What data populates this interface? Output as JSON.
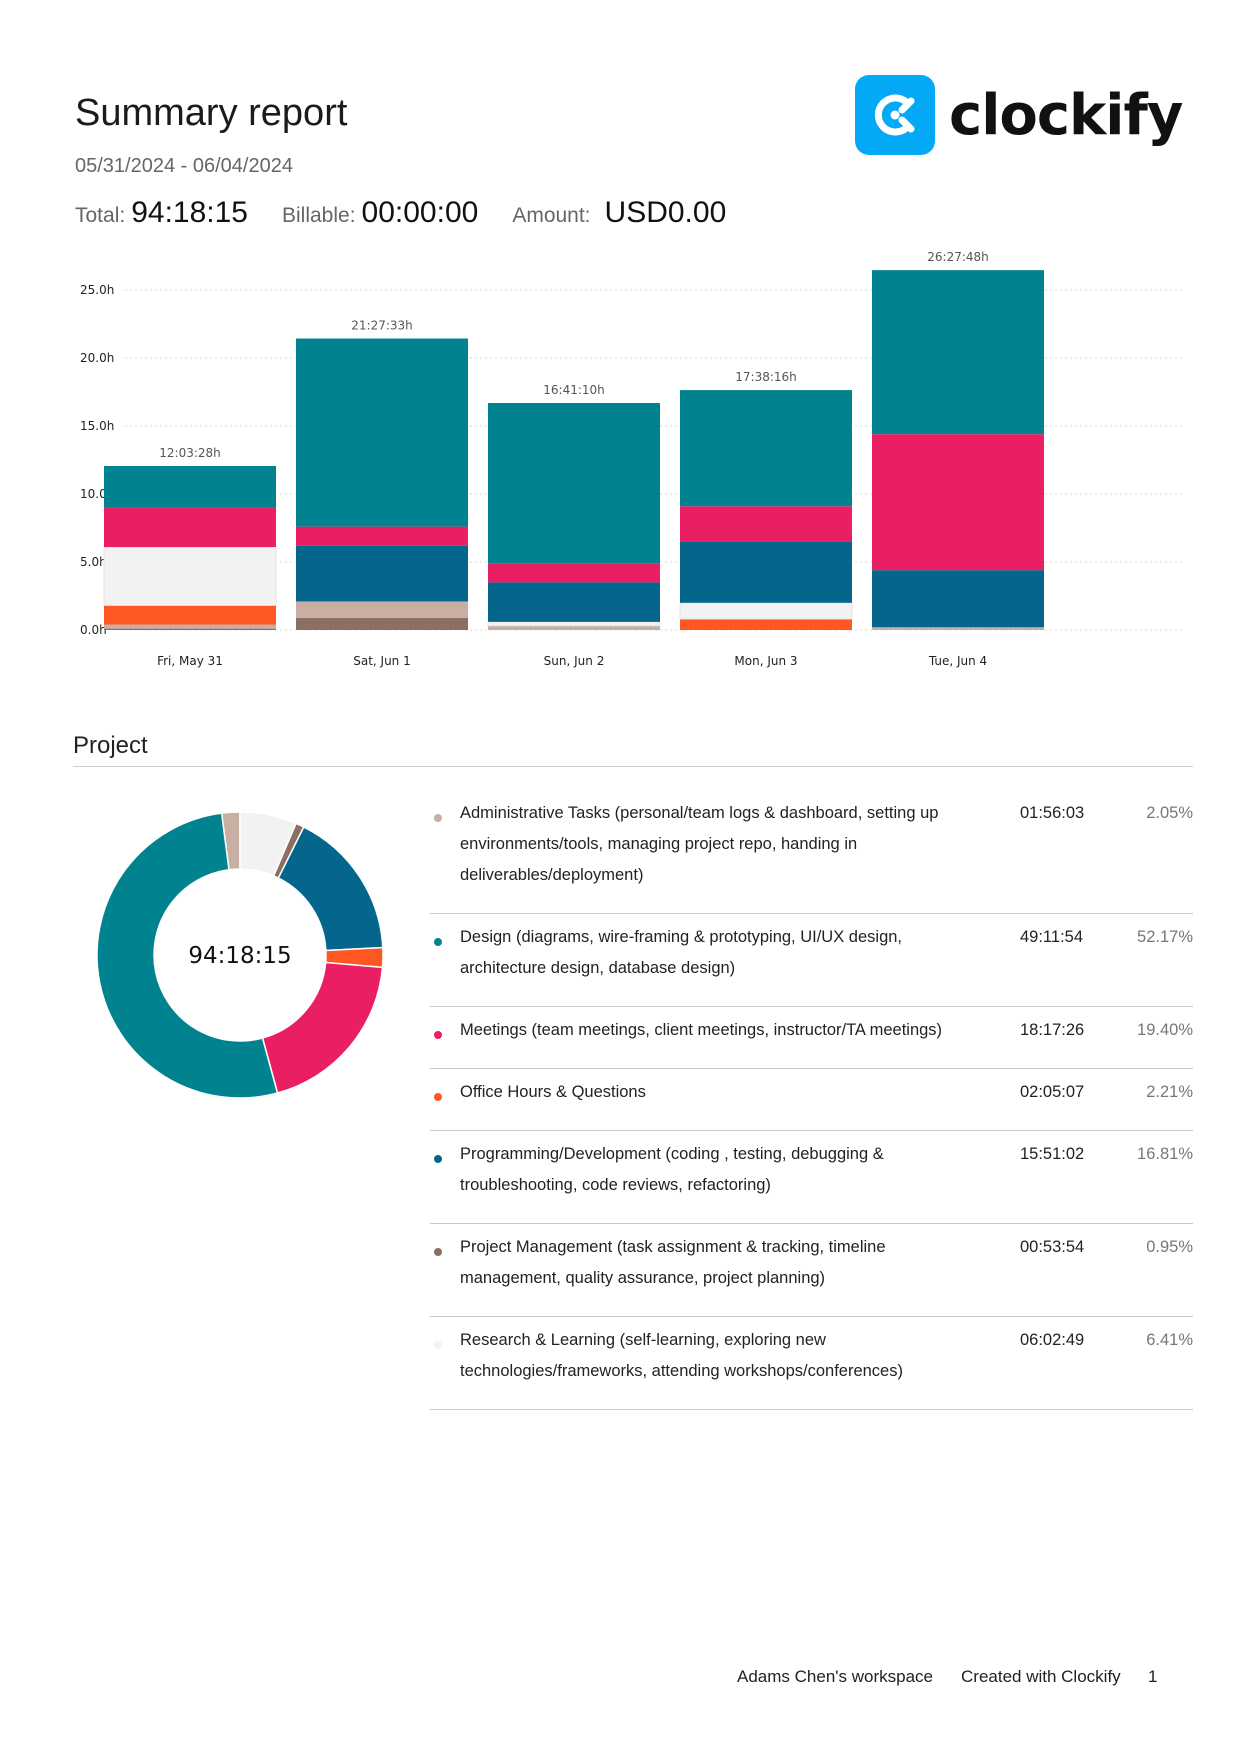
{
  "header": {
    "title": "Summary report",
    "date_range": "05/31/2024 - 06/04/2024",
    "total_label": "Total:",
    "total_value": "94:18:15",
    "billable_label": "Billable:",
    "billable_value": "00:00:00",
    "amount_label": "Amount:",
    "amount_value": "USD0.00"
  },
  "logo": {
    "text": "clockify",
    "icon": "clockify-logo-icon",
    "color": "#03a9f4"
  },
  "colors": {
    "admin": "#c9aea4",
    "design": "#00838f",
    "meetings": "#e91e63",
    "office": "#ff5722",
    "programming": "#04668d",
    "pm": "#8d6e63",
    "research": "#f2f2f2"
  },
  "chart_data": {
    "type": "bar",
    "stacked": true,
    "categories": [
      "Fri, May 31",
      "Sat, Jun 1",
      "Sun, Jun 2",
      "Mon, Jun 3",
      "Tue, Jun 4"
    ],
    "totals_labels": [
      "12:03:28h",
      "21:27:33h",
      "16:41:10h",
      "17:38:16h",
      "26:27:48h"
    ],
    "yticks": [
      "0.0h",
      "5.0h",
      "10.0h",
      "15.0h",
      "20.0h",
      "25.0h"
    ],
    "ylim": [
      0,
      25
    ],
    "grid": true,
    "series": [
      {
        "key": "pm",
        "values": [
          0.1,
          0.9,
          0,
          0,
          0
        ]
      },
      {
        "key": "admin",
        "values": [
          0.3,
          1.2,
          0.3,
          0,
          0.2
        ]
      },
      {
        "key": "office",
        "values": [
          1.4,
          0,
          0,
          0.8,
          0
        ]
      },
      {
        "key": "research",
        "values": [
          4.3,
          0,
          0.3,
          1.2,
          0
        ]
      },
      {
        "key": "programming",
        "values": [
          0,
          4.1,
          2.9,
          4.5,
          4.2
        ]
      },
      {
        "key": "meetings",
        "values": [
          2.9,
          1.4,
          1.4,
          2.6,
          10.0
        ]
      },
      {
        "key": "design",
        "values": [
          3.06,
          13.83,
          11.79,
          8.54,
          12.06
        ]
      }
    ]
  },
  "donut": {
    "center_label": "94:18:15",
    "slices": [
      {
        "key": "admin",
        "percent": 2.05
      },
      {
        "key": "research",
        "percent": 6.41
      },
      {
        "key": "pm",
        "percent": 0.95
      },
      {
        "key": "programming",
        "percent": 16.81
      },
      {
        "key": "office",
        "percent": 2.21
      },
      {
        "key": "meetings",
        "percent": 19.4
      },
      {
        "key": "design",
        "percent": 52.17
      }
    ]
  },
  "section": {
    "title": "Project"
  },
  "projects": [
    {
      "key": "admin",
      "name": "Administrative Tasks (personal/team logs & dashboard, setting up environments/tools, managing project repo, handing in deliverables/deployment)",
      "duration": "01:56:03",
      "percent": "2.05%"
    },
    {
      "key": "design",
      "name": "Design (diagrams, wire-framing & prototyping, UI/UX design, architecture design, database design)",
      "duration": "49:11:54",
      "percent": "52.17%"
    },
    {
      "key": "meetings",
      "name": "Meetings (team meetings, client meetings, instructor/TA meetings)",
      "duration": "18:17:26",
      "percent": "19.40%"
    },
    {
      "key": "office",
      "name": "Office Hours & Questions",
      "duration": "02:05:07",
      "percent": "2.21%"
    },
    {
      "key": "programming",
      "name": "Programming/Development (coding , testing, debugging & troubleshooting, code reviews, refactoring)",
      "duration": "15:51:02",
      "percent": "16.81%"
    },
    {
      "key": "pm",
      "name": "Project Management (task assignment & tracking, timeline management, quality assurance, project planning)",
      "duration": "00:53:54",
      "percent": "0.95%"
    },
    {
      "key": "research",
      "name": "Research & Learning (self-learning, exploring new technologies/frameworks, attending workshops/conferences)",
      "duration": "06:02:49",
      "percent": "6.41%"
    }
  ],
  "footer": {
    "workspace": "Adams Chen's workspace",
    "created_with": "Created with Clockify",
    "page": "1"
  }
}
